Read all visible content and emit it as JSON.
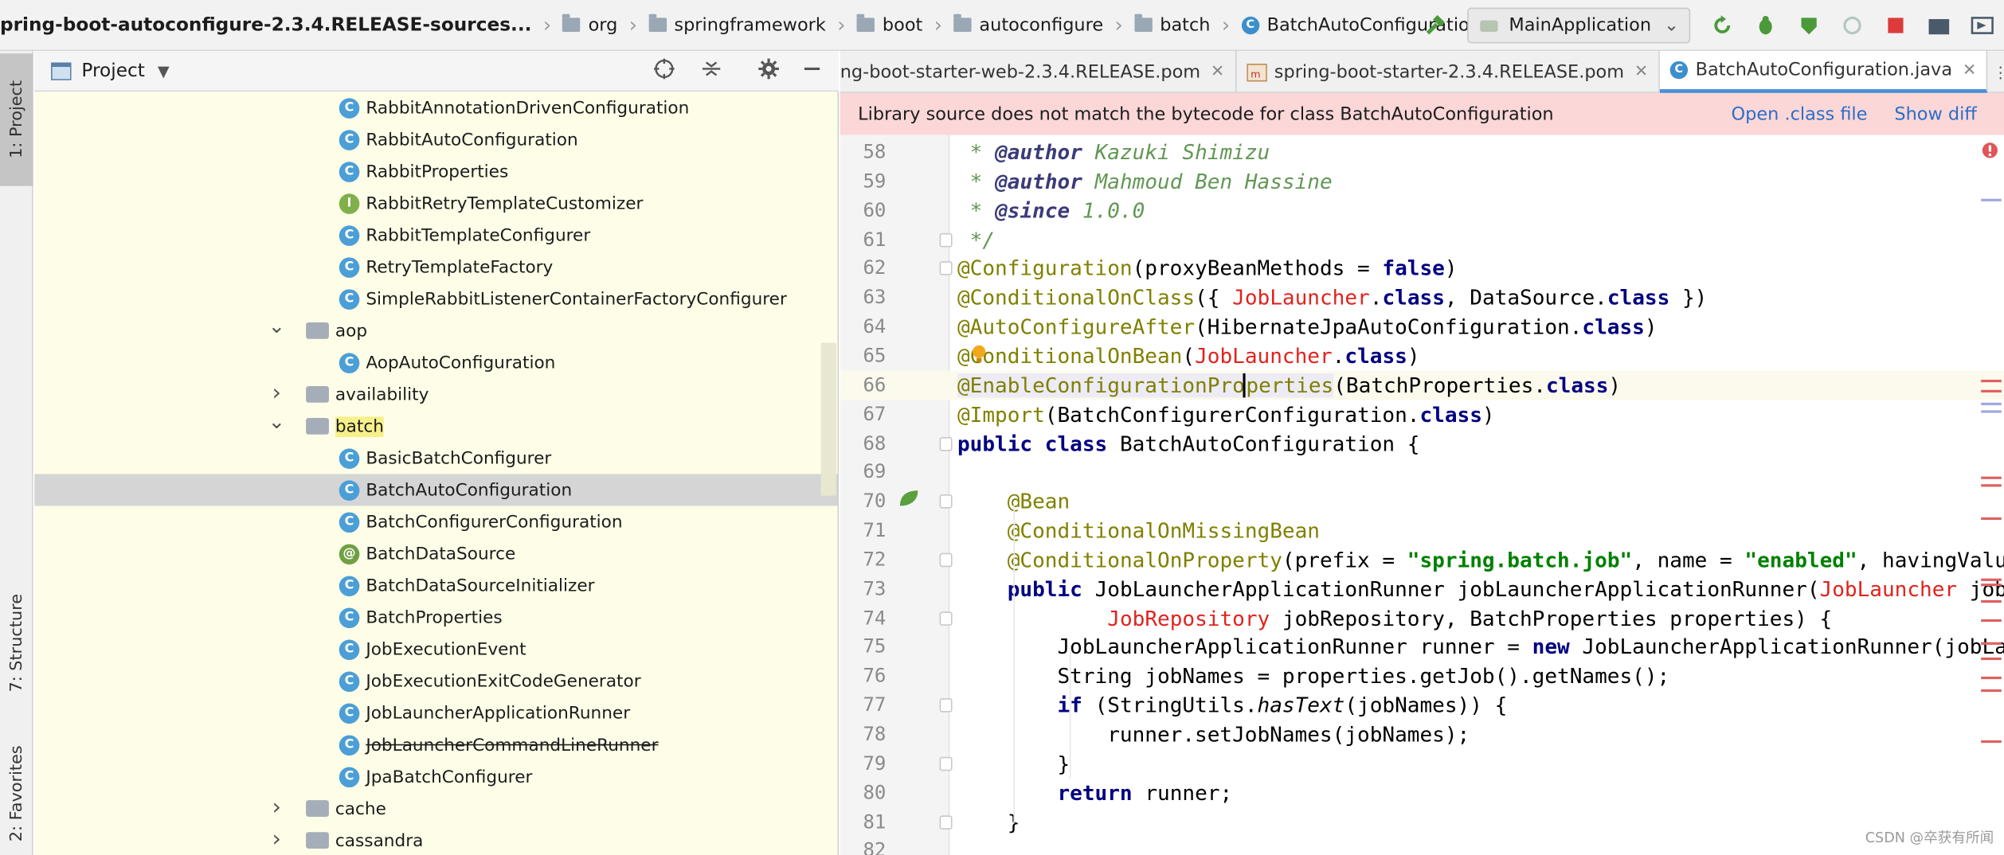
{
  "breadcrumb": {
    "items": [
      "pring-boot-autoconfigure-2.3.4.RELEASE-sources...",
      "org",
      "springframework",
      "boot",
      "autoconfigure",
      "batch",
      "BatchAutoConfiguration"
    ]
  },
  "toolbar": {
    "run_config": "MainApplication"
  },
  "left_strip": {
    "project_tab": "1: Project",
    "structure_tab": "7: Structure",
    "favorites_tab": "2: Favorites"
  },
  "project_panel": {
    "title": "Project",
    "rows": [
      {
        "label": "RabbitAnnotationDrivenConfiguration",
        "icon": "c"
      },
      {
        "label": "RabbitAutoConfiguration",
        "icon": "c"
      },
      {
        "label": "RabbitProperties",
        "icon": "c"
      },
      {
        "label": "RabbitRetryTemplateCustomizer",
        "icon": "i"
      },
      {
        "label": "RabbitTemplateConfigurer",
        "icon": "c"
      },
      {
        "label": "RetryTemplateFactory",
        "icon": "c"
      },
      {
        "label": "SimpleRabbitListenerContainerFactoryConfigurer",
        "icon": "c"
      },
      {
        "label": "aop",
        "icon": "folder"
      },
      {
        "label": "AopAutoConfiguration",
        "icon": "c"
      },
      {
        "label": "availability",
        "icon": "folder"
      },
      {
        "label": "batch",
        "icon": "folder"
      },
      {
        "label": "BasicBatchConfigurer",
        "icon": "c"
      },
      {
        "label": "BatchAutoConfiguration",
        "icon": "c"
      },
      {
        "label": "BatchConfigurerConfiguration",
        "icon": "c"
      },
      {
        "label": "BatchDataSource",
        "icon": "a"
      },
      {
        "label": "BatchDataSourceInitializer",
        "icon": "c"
      },
      {
        "label": "BatchProperties",
        "icon": "c"
      },
      {
        "label": "JobExecutionEvent",
        "icon": "c"
      },
      {
        "label": "JobExecutionExitCodeGenerator",
        "icon": "c"
      },
      {
        "label": "JobLauncherApplicationRunner",
        "icon": "c"
      },
      {
        "label": "JobLauncherCommandLineRunner",
        "icon": "c"
      },
      {
        "label": "JpaBatchConfigurer",
        "icon": "c"
      },
      {
        "label": "cache",
        "icon": "folder"
      },
      {
        "label": "cassandra",
        "icon": "folder"
      }
    ]
  },
  "tabs": [
    {
      "label": "ng-boot-starter-web-2.3.4.RELEASE.pom"
    },
    {
      "label": "spring-boot-starter-2.3.4.RELEASE.pom"
    },
    {
      "label": "BatchAutoConfiguration.java"
    }
  ],
  "banner": {
    "message": "Library source does not match the bytecode for class BatchAutoConfiguration",
    "open_class": "Open .class file",
    "show_diff": "Show diff"
  },
  "editor": {
    "line_numbers": [
      "58",
      "59",
      "60",
      "61",
      "62",
      "63",
      "64",
      "65",
      "66",
      "67",
      "68",
      "69",
      "70",
      "71",
      "72",
      "73",
      "74",
      "75",
      "76",
      "77",
      "78",
      "79",
      "80",
      "81",
      "82"
    ]
  },
  "watermark": "CSDN @卒获有所闻",
  "colors": {
    "project_bg": "#fefee8",
    "banner_bg": "#fbd7d7",
    "keyword": "#000080",
    "annotation": "#808000",
    "string": "#008000"
  }
}
